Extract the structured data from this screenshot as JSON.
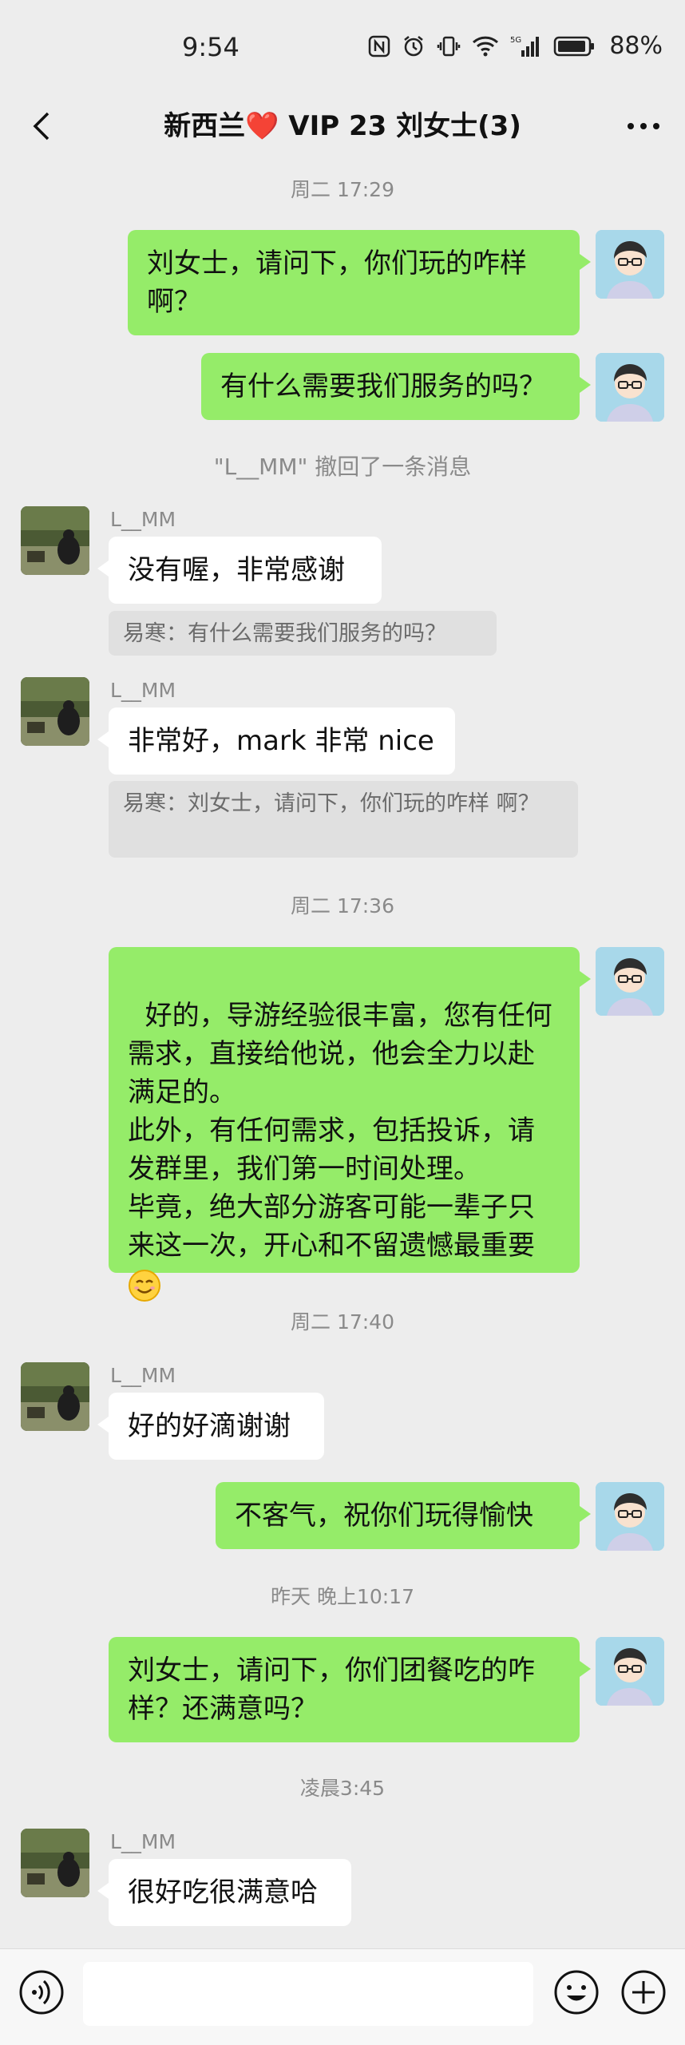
{
  "status_bar": {
    "time": "9:54",
    "network": "5G",
    "battery": "88%"
  },
  "header": {
    "title_prefix": "新西兰",
    "title_heart": "❤️",
    "title_suffix": " VIP 23  刘女士(3)",
    "back_icon": "chevron-left-icon",
    "more_icon": "more-dots-icon"
  },
  "chat": {
    "time_1": "周二 17:29",
    "msg_1": "刘女士，请问下，你们玩的咋样\n啊？",
    "msg_2": "有什么需要我们服务的吗？",
    "system_1": "\"L__MM\" 撤回了一条消息",
    "sender_1": "L__MM",
    "msg_3": "没有喔，非常感谢",
    "quote_1": "易寒：有什么需要我们服务的吗？",
    "sender_2": "L__MM",
    "msg_4": "非常好，mark 非常 nice",
    "quote_2": "易寒：刘女士，请问下，你们玩的咋样\n啊？",
    "time_2": "周二 17:36",
    "msg_5": "好的，导游经验很丰富，您有任何\n需求，直接给他说，他会全力以赴\n满足的。\n此外，有任何需求，包括投诉，请\n发群里，我们第一时间处理。\n毕竟，绝大部分游客可能一辈子只\n来这一次，开心和不留遗憾最重要",
    "time_3": "周二 17:40",
    "sender_3": "L__MM",
    "msg_6": "好的好滴谢谢",
    "msg_7": "不客气，祝你们玩得愉快",
    "time_4": "昨天 晚上10:17",
    "msg_8": "刘女士，请问下，你们团餐吃的咋\n样？还满意吗？",
    "time_5": "凌晨3:45",
    "sender_4": "L__MM",
    "msg_9": "很好吃很满意哈"
  },
  "bottom_bar": {
    "input_value": "",
    "voice_icon": "voice-icon",
    "emoji_icon": "emoji-icon",
    "plus_icon": "plus-icon"
  },
  "colors": {
    "my_bubble": "#95ec69",
    "their_bubble": "#ffffff",
    "background": "#ededed"
  }
}
